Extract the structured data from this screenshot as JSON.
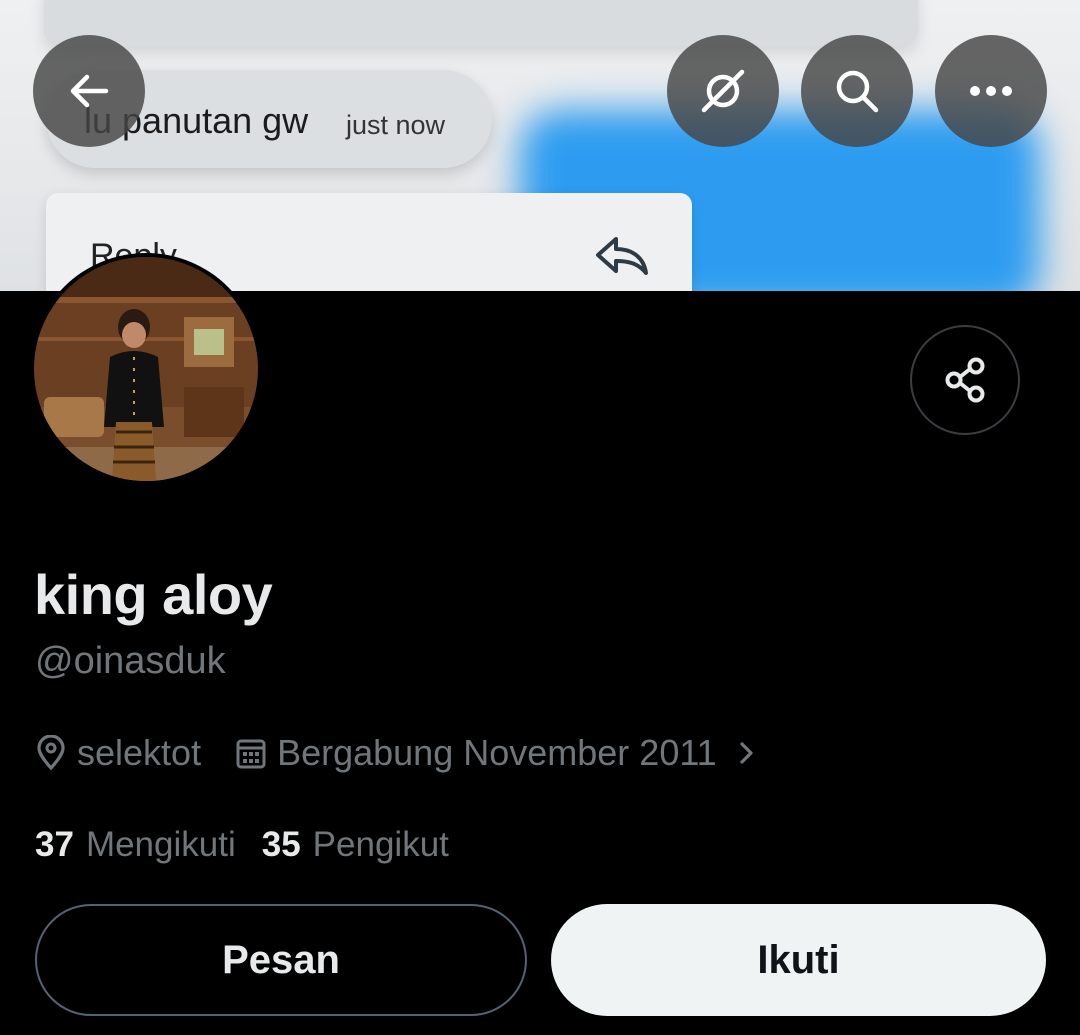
{
  "banner": {
    "message_text": "lu panutan gw",
    "message_time": "just now",
    "reply_text": "Reply"
  },
  "nav": {
    "back_icon": "arrow-left-icon",
    "hide_icon": "eye-slash-icon",
    "search_icon": "search-icon",
    "more_icon": "more-dots-icon"
  },
  "profile": {
    "display_name": "king aloy",
    "handle": "@oinasduk",
    "location": "selektot",
    "joined": "Bergabung November 2011",
    "following_count": "37",
    "following_label": "Mengikuti",
    "followers_count": "35",
    "followers_label": "Pengikut"
  },
  "actions": {
    "message_label": "Pesan",
    "follow_label": "Ikuti"
  },
  "colors": {
    "background": "#000000",
    "primary_text": "#e7e9ea",
    "secondary_text": "#71767b",
    "follow_button_bg": "#eff3f4"
  }
}
